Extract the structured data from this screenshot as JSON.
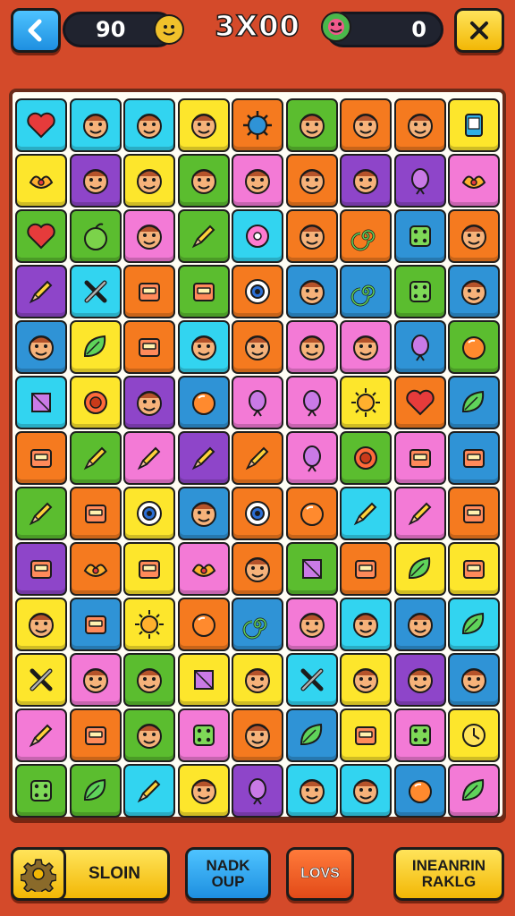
{
  "header": {
    "back_icon": "chevron-left-icon",
    "coins": "90",
    "score": "3X00",
    "opponent_value": "0",
    "close_icon": "close-icon"
  },
  "board": {
    "columns": 9,
    "rows": 13,
    "tiles": [
      [
        "cyan:heart",
        "cyan:face",
        "cyan:face",
        "yellow:face",
        "orange:virus",
        "green:face",
        "orange:face",
        "orange:face",
        "yellow:phone"
      ],
      [
        "yellow:bird",
        "purple:face",
        "yellow:face",
        "green:face",
        "pink:face",
        "orange:face",
        "purple:face",
        "purple:bean",
        "pink:bird"
      ],
      [
        "green:heart",
        "green:apple",
        "pink:face",
        "green:pencil",
        "cyan:donut",
        "orange:face",
        "orange:swirl",
        "blue:dice",
        "orange:face"
      ],
      [
        "purple:pencil",
        "cyan:tool",
        "orange:box",
        "green:box",
        "orange:eye",
        "blue:face",
        "blue:swirl",
        "green:dice",
        "blue:face"
      ],
      [
        "blue:face",
        "yellow:leaf",
        "orange:box",
        "cyan:face",
        "orange:face",
        "pink:face",
        "pink:face",
        "blue:bean",
        "green:orb"
      ],
      [
        "cyan:square",
        "yellow:flower",
        "purple:face",
        "blue:orb",
        "pink:bean",
        "pink:bean",
        "yellow:sun",
        "orange:heart",
        "blue:leaf"
      ],
      [
        "orange:box",
        "green:pencil",
        "pink:pencil",
        "purple:pencil",
        "orange:pencil",
        "pink:bean",
        "green:flower",
        "pink:box",
        "blue:box"
      ],
      [
        "green:pencil",
        "orange:box",
        "yellow:eye",
        "blue:face",
        "orange:eye",
        "orange:orb",
        "cyan:pencil",
        "pink:pencil",
        "orange:box"
      ],
      [
        "purple:box",
        "orange:bird",
        "yellow:box",
        "pink:bird",
        "orange:face",
        "green:square",
        "orange:box",
        "yellow:leaf",
        "yellow:box"
      ],
      [
        "yellow:face",
        "blue:box",
        "yellow:sun",
        "orange:orb",
        "blue:swirl",
        "pink:face",
        "cyan:face",
        "blue:face",
        "cyan:leaf"
      ],
      [
        "yellow:tool",
        "pink:face",
        "green:face",
        "yellow:square",
        "yellow:face",
        "cyan:tool",
        "yellow:face",
        "purple:face",
        "blue:face"
      ],
      [
        "pink:pencil",
        "orange:box",
        "green:face",
        "pink:dice",
        "orange:face",
        "blue:leaf",
        "yellow:box",
        "pink:dice",
        "yellow:clock"
      ],
      [
        "green:dice",
        "green:leaf",
        "cyan:pencil",
        "yellow:face",
        "purple:bean",
        "cyan:face",
        "cyan:face",
        "blue:orb",
        "pink:leaf"
      ]
    ]
  },
  "palette": {
    "red": "#e8452e",
    "orange": "#f57a1f",
    "yellow": "#fde62c",
    "green": "#5bbd2f",
    "cyan": "#32d4f0",
    "blue": "#2f93d6",
    "purple": "#8e45c9",
    "pink": "#f37ad6",
    "background": "#d44a2a",
    "board": "#fffdf4"
  },
  "footer": {
    "gear_icon": "gear-icon",
    "button1": "SLOIN",
    "button2_line1": "NADK",
    "button2_line2": "OUP",
    "button3": "LOVS",
    "button4_line1": "INEANRIN",
    "button4_line2": "RAKLG"
  }
}
